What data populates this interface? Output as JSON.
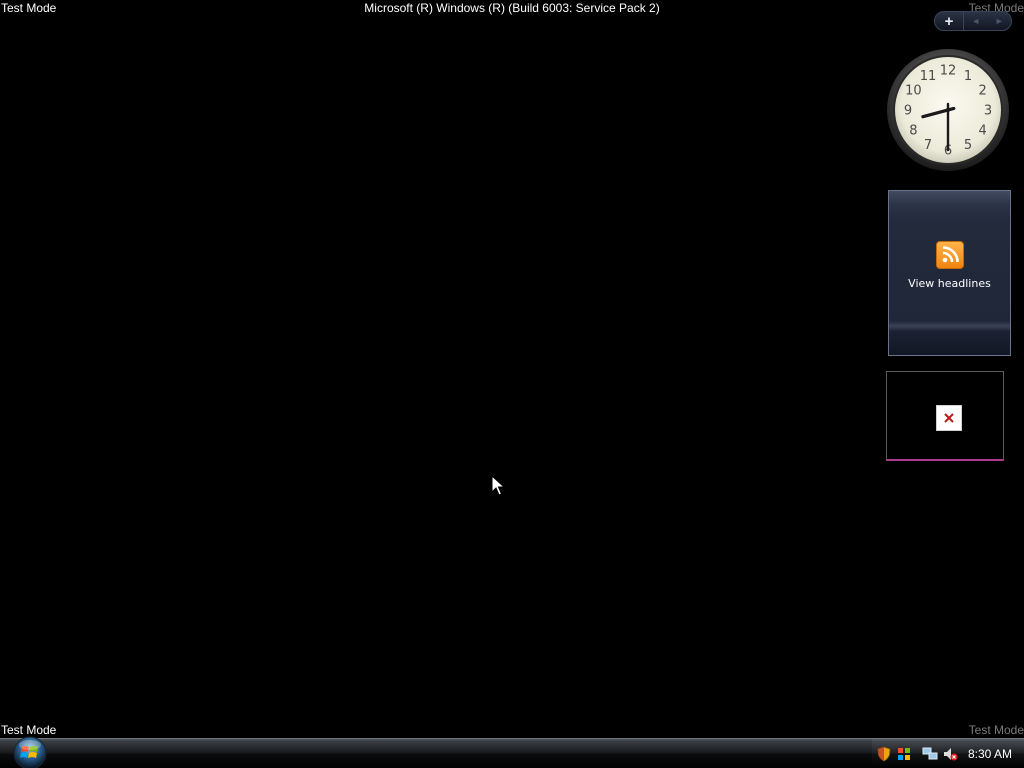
{
  "watermarks": {
    "top_left": "Test Mode",
    "top_center": "Microsoft (R) Windows (R) (Build 6003: Service Pack 2)",
    "top_right": "Test Mode",
    "bottom_left": "Test Mode",
    "bottom_right": "Test Mode"
  },
  "sidebar": {
    "controls": {
      "add_label": "+",
      "prev_icon": "◄",
      "next_icon": "►"
    },
    "clock_gadget": {
      "numerals": [
        "12",
        "1",
        "2",
        "3",
        "4",
        "5",
        "6",
        "7",
        "8",
        "9",
        "10",
        "11"
      ],
      "time_hours": 8,
      "time_minutes": 30
    },
    "feed_gadget": {
      "icon": "rss-feed-icon",
      "label": "View headlines"
    },
    "broken_gadget": {
      "icon": "broken-image-icon"
    }
  },
  "taskbar": {
    "start_icon": "windows-start-orb",
    "tray": {
      "icons": [
        "security-shield-icon",
        "windows-update-icon",
        "network-icon",
        "volume-muted-icon"
      ],
      "time": "8:30 AM"
    }
  },
  "colors": {
    "desktop": "#000000",
    "feed_icon": "#f08410",
    "broken_accent": "#b03a8a"
  }
}
